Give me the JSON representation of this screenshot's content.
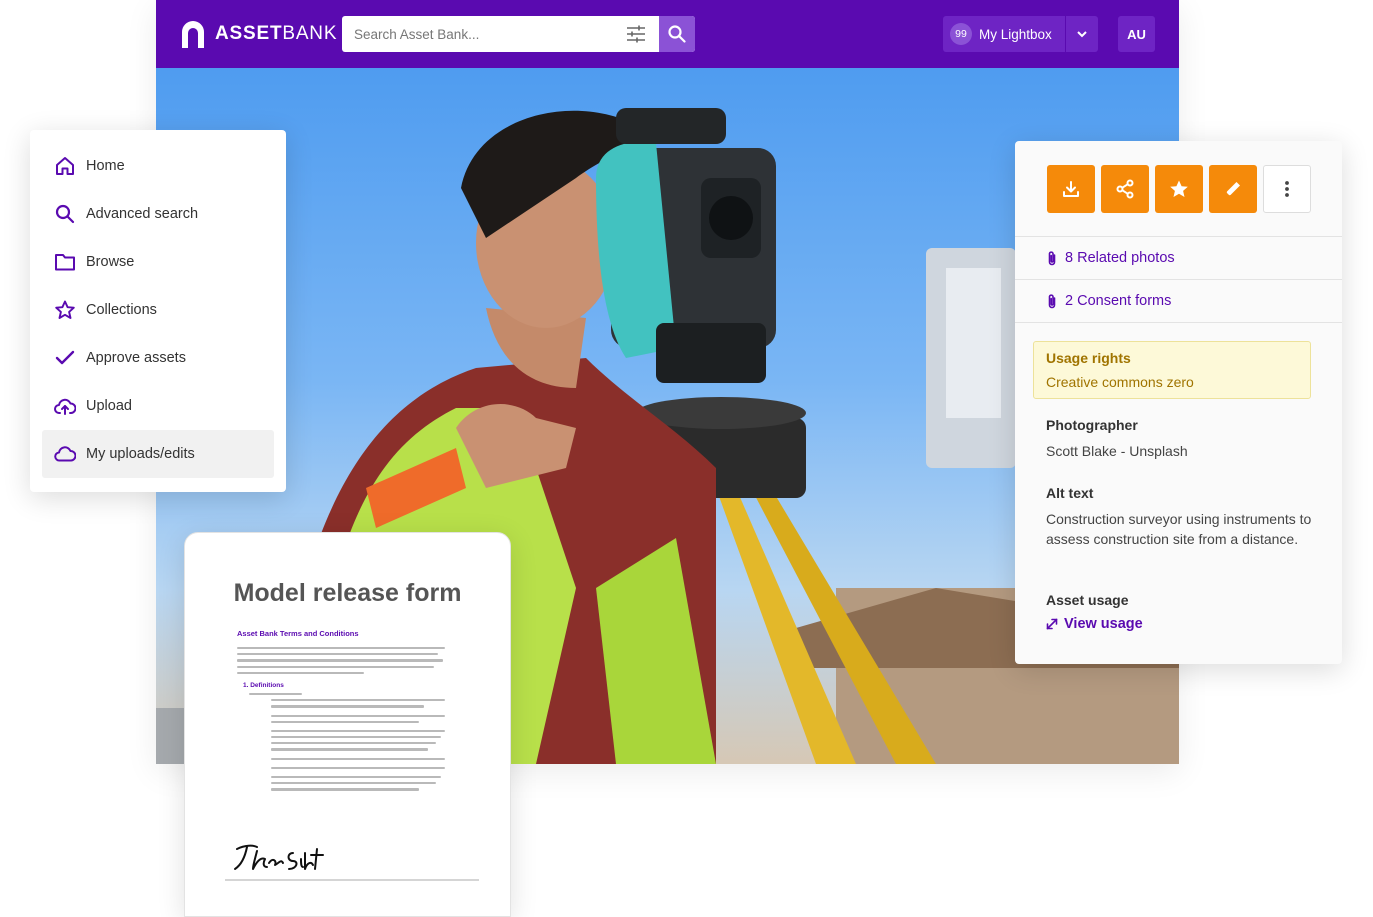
{
  "app": {
    "brand": {
      "prefix": "ASSET",
      "suffix": "BANK"
    },
    "search": {
      "placeholder": "Search Asset Bank..."
    },
    "lightbox": {
      "count": "99",
      "label": "My Lightbox"
    },
    "user_initials": "AU",
    "colors": {
      "brand_purple": "#5a0ab0",
      "accent_purple": "#8b52d6",
      "action_orange": "#f58a0a"
    }
  },
  "nav": {
    "items": [
      {
        "label": "Home",
        "icon": "home-icon"
      },
      {
        "label": "Advanced search",
        "icon": "search-icon"
      },
      {
        "label": "Browse",
        "icon": "folder-icon"
      },
      {
        "label": "Collections",
        "icon": "star-icon"
      },
      {
        "label": "Approve assets",
        "icon": "check-icon"
      },
      {
        "label": "Upload",
        "icon": "cloud-upload-icon"
      },
      {
        "label": "My uploads/edits",
        "icon": "cloud-icon",
        "active": true
      }
    ]
  },
  "panel": {
    "actions": [
      {
        "name": "download",
        "icon": "download-icon"
      },
      {
        "name": "share",
        "icon": "share-icon"
      },
      {
        "name": "favourite",
        "icon": "star-icon"
      },
      {
        "name": "edit",
        "icon": "pencil-icon"
      },
      {
        "name": "more",
        "icon": "more-vertical-icon"
      }
    ],
    "related_photos": "8 Related photos",
    "consent_forms": "2 Consent forms",
    "usage_rights": {
      "label": "Usage rights",
      "value": "Creative commons zero"
    },
    "photographer": {
      "label": "Photographer",
      "value": "Scott Blake - Unsplash"
    },
    "alt_text": {
      "label": "Alt text",
      "value": "Construction surveyor using instruments to assess construction site from a distance."
    },
    "asset_usage": {
      "label": "Asset usage",
      "link": "View usage"
    }
  },
  "form_card": {
    "title": "Model release form",
    "doc_heading": "Asset Bank Terms and Conditions",
    "doc_section": "1.   Definitions"
  }
}
